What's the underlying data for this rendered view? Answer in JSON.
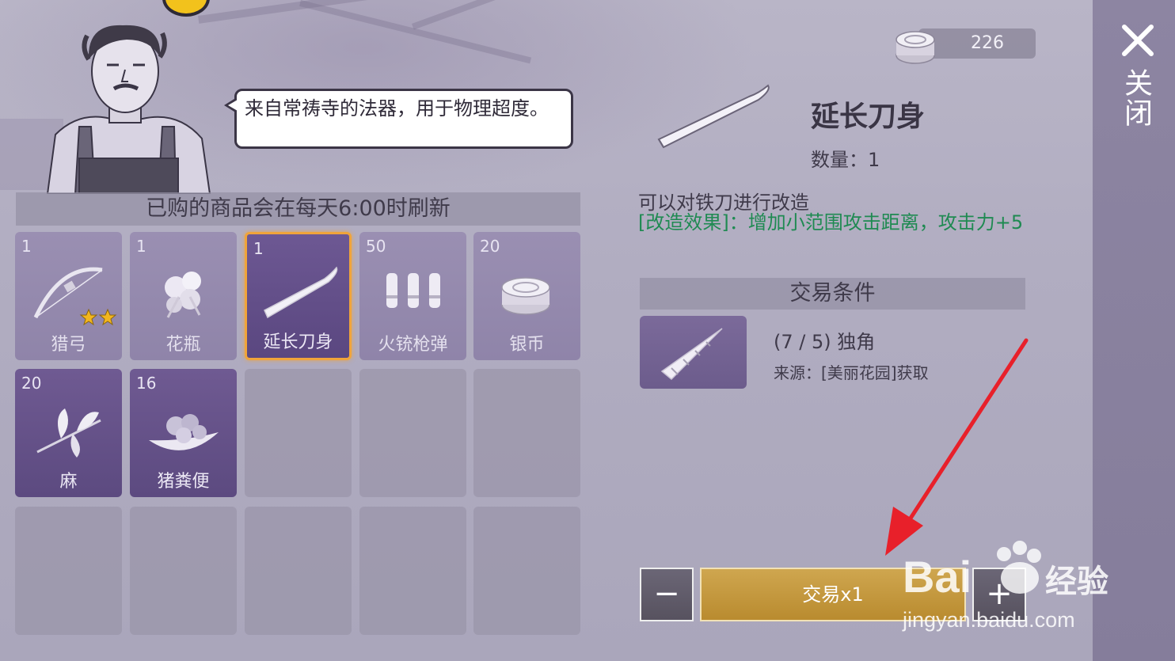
{
  "npc": {
    "speech": "来自常祷寺的法器，用于物理超度。"
  },
  "shop": {
    "refresh_note": "已购的商品会在每天6:00时刷新",
    "items": [
      {
        "qty": "1",
        "name": "猎弓",
        "icon": "bow-icon",
        "state": "item",
        "stars": 2
      },
      {
        "qty": "1",
        "name": "花瓶",
        "icon": "flower-icon",
        "state": "item"
      },
      {
        "qty": "1",
        "name": "延长刀身",
        "icon": "blade-icon",
        "state": "selected"
      },
      {
        "qty": "50",
        "name": "火铳枪弹",
        "icon": "bullets-icon",
        "state": "item"
      },
      {
        "qty": "20",
        "name": "银币",
        "icon": "coin-icon",
        "state": "item"
      },
      {
        "qty": "20",
        "name": "麻",
        "icon": "hemp-icon",
        "state": "owned"
      },
      {
        "qty": "16",
        "name": "猪粪便",
        "icon": "dung-icon",
        "state": "owned"
      }
    ]
  },
  "currency": {
    "amount": "226",
    "icon": "silver-coin-icon"
  },
  "detail": {
    "title": "延长刀身",
    "qty_label": "数量：1",
    "description": "可以对铁刀进行改造",
    "effect": "[改造效果]：增加小范围攻击距离，攻击力+5",
    "conditions_title": "交易条件",
    "cond_count": "(7 / 5) 独角",
    "cond_source": "来源：[美丽花园]获取",
    "cond_icon": "horn-icon"
  },
  "trade": {
    "minus": "−",
    "button": "交易x1",
    "plus": "+"
  },
  "close_label": "关闭",
  "watermark": {
    "brand": "Bai",
    "suffix": "经验",
    "url": "jingyan.baidu.com"
  },
  "colors": {
    "selected_border": "#f0a43a",
    "trade_button": "#c39a41",
    "effect_text": "#1f8a52",
    "arrow": "#e8202a"
  }
}
